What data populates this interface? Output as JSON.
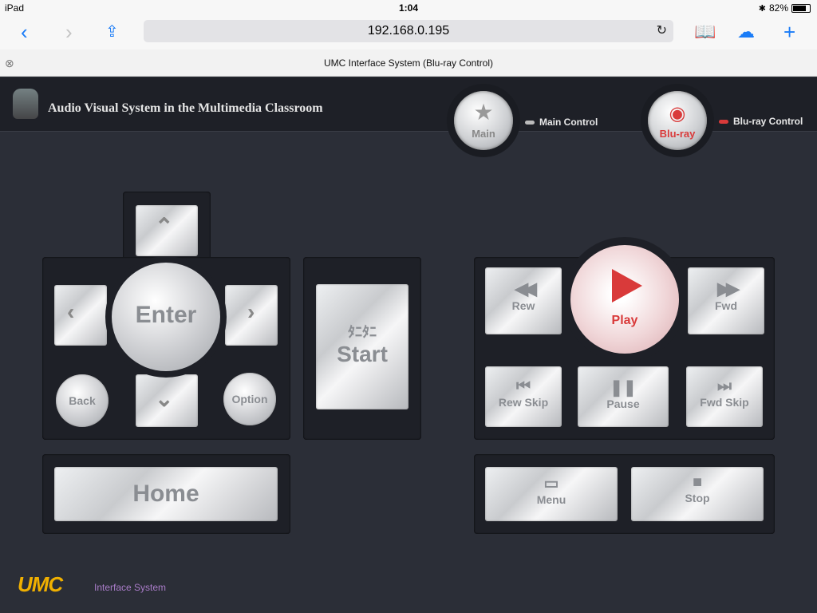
{
  "statusbar": {
    "device": "iPad",
    "time": "1:04",
    "battery": "82%",
    "battery_level": 0.82
  },
  "browser": {
    "url": "192.168.0.195",
    "tab_title": "UMC Interface System (Blu-ray Control)"
  },
  "header": {
    "title": "Audio Visual System in the Multimedia Classroom",
    "main_button": "Main",
    "main_caption": "Main Control",
    "bluray_button": "Blu-ray",
    "bluray_caption": "Blu-ray Control"
  },
  "nav": {
    "enter": "Enter",
    "back": "Back",
    "option": "Option",
    "start_symbol": "ﾀﾆﾀﾆ",
    "start": "Start",
    "home": "Home"
  },
  "transport": {
    "rew": "Rew",
    "play": "Play",
    "fwd": "Fwd",
    "rew_skip": "Rew Skip",
    "pause": "Pause",
    "fwd_skip": "Fwd Skip",
    "menu": "Menu",
    "stop": "Stop"
  },
  "footer": {
    "brand": "UMC",
    "text": "Interface System"
  },
  "colors": {
    "accent_red": "#d93a3a",
    "bg": "#2b2e37",
    "panel": "#1e2027",
    "ios_blue": "#1a7cf7"
  }
}
